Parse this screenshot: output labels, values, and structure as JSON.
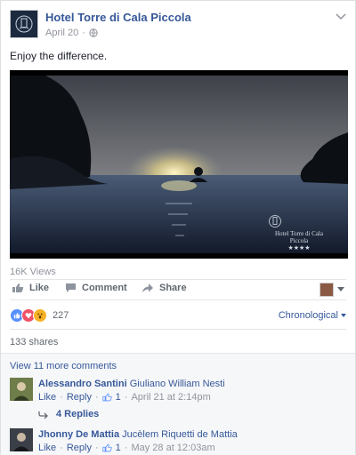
{
  "post": {
    "page_name": "Hotel Torre di Cala Piccola",
    "date": "April 20",
    "text": "Enjoy the difference.",
    "video_overlay_label": "Hotel Torre di Cala Piccola",
    "views": "16K Views"
  },
  "actions": {
    "like": "Like",
    "comment": "Comment",
    "share": "Share"
  },
  "reactions": {
    "count": "227",
    "sort_label": "Chronological"
  },
  "shares_text": "133 shares",
  "comments": {
    "view_more": "View 11 more comments",
    "items": [
      {
        "author": "Alessandro Santini",
        "mention": "Giuliano William Nesti",
        "like": "Like",
        "reply": "Reply",
        "likes": "1",
        "timestamp": "April 21 at 2:14pm",
        "replies_label": "4 Replies"
      },
      {
        "author": "Jhonny De Mattia",
        "mention": "Jucèlem Riquetti de Mattia",
        "like": "Like",
        "reply": "Reply",
        "likes": "1",
        "timestamp": "May 28 at 12:03am"
      }
    ]
  },
  "colors": {
    "link": "#365899",
    "meta": "#90949c",
    "like_blue": "#5890ff",
    "love_red": "#f25268",
    "wow_yellow": "#f7b125"
  }
}
